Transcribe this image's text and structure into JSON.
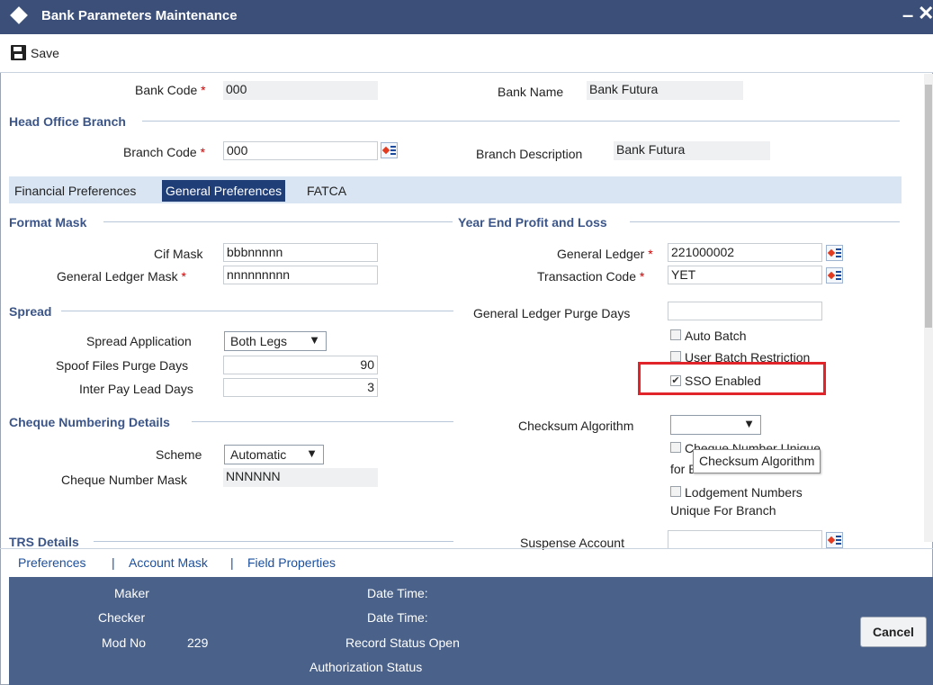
{
  "window": {
    "title": "Bank Parameters Maintenance",
    "min_glyph": "–",
    "close_glyph": "✕"
  },
  "toolbar": {
    "save_label": "Save"
  },
  "header": {
    "bank_code_label": "Bank Code",
    "bank_code_value": "000",
    "bank_name_label": "Bank Name",
    "bank_name_value": "Bank Futura",
    "head_office_section": "Head Office Branch",
    "branch_code_label": "Branch Code",
    "branch_code_value": "000",
    "branch_desc_label": "Branch Description",
    "branch_desc_value": "Bank Futura",
    "required_mark": "*"
  },
  "tabs": [
    {
      "label": "Financial Preferences",
      "active": false
    },
    {
      "label": "General Preferences",
      "active": true
    },
    {
      "label": "FATCA",
      "active": false
    }
  ],
  "format_mask": {
    "section": "Format Mask",
    "cif_mask_label": "Cif Mask",
    "cif_mask_value": "bbbnnnnn",
    "gl_mask_label": "General Ledger Mask",
    "gl_mask_value": "nnnnnnnnn"
  },
  "spread": {
    "section": "Spread",
    "application_label": "Spread Application",
    "application_value": "Both Legs",
    "spoof_label": "Spoof Files Purge Days",
    "spoof_value": "90",
    "interpay_label": "Inter Pay Lead Days",
    "interpay_value": "3"
  },
  "cheque": {
    "section": "Cheque Numbering Details",
    "scheme_label": "Scheme",
    "scheme_value": "Automatic",
    "mask_label": "Cheque Number Mask",
    "mask_value": "NNNNNN"
  },
  "trs": {
    "section": "TRS Details"
  },
  "year_end": {
    "section": "Year End Profit and Loss",
    "gl_label": "General Ledger",
    "gl_value": "221000002",
    "txn_label": "Transaction Code",
    "txn_value": "YET"
  },
  "right": {
    "purge_label": "General Ledger Purge Days",
    "purge_value": "",
    "auto_batch_label": "Auto Batch",
    "user_batch_label": "User Batch Restriction",
    "sso_label": "SSO Enabled",
    "checksum_label": "Checksum Algorithm",
    "checksum_value": "",
    "cheque_unique_label_1": "Cheque Number Unique",
    "cheque_unique_label_2": "for Branch",
    "lodgement_label_1": "Lodgement Numbers",
    "lodgement_label_2": "Unique For Branch",
    "suspense_label": "Suspense Account",
    "suspense_value": ""
  },
  "tooltip": {
    "text": "Checksum Algorithm"
  },
  "links": {
    "preferences": "Preferences",
    "account_mask": "Account Mask",
    "field_properties": "Field Properties",
    "separator": "|"
  },
  "footer": {
    "maker_label": "Maker",
    "checker_label": "Checker",
    "modno_label": "Mod No",
    "modno_value": "229",
    "datetime_label": "Date Time:",
    "record_status_label": "Record Status",
    "record_status_value": "Open",
    "auth_status_label": "Authorization Status",
    "cancel_label": "Cancel"
  },
  "checked_glyph": "✔",
  "dropdown_caret": "▼"
}
